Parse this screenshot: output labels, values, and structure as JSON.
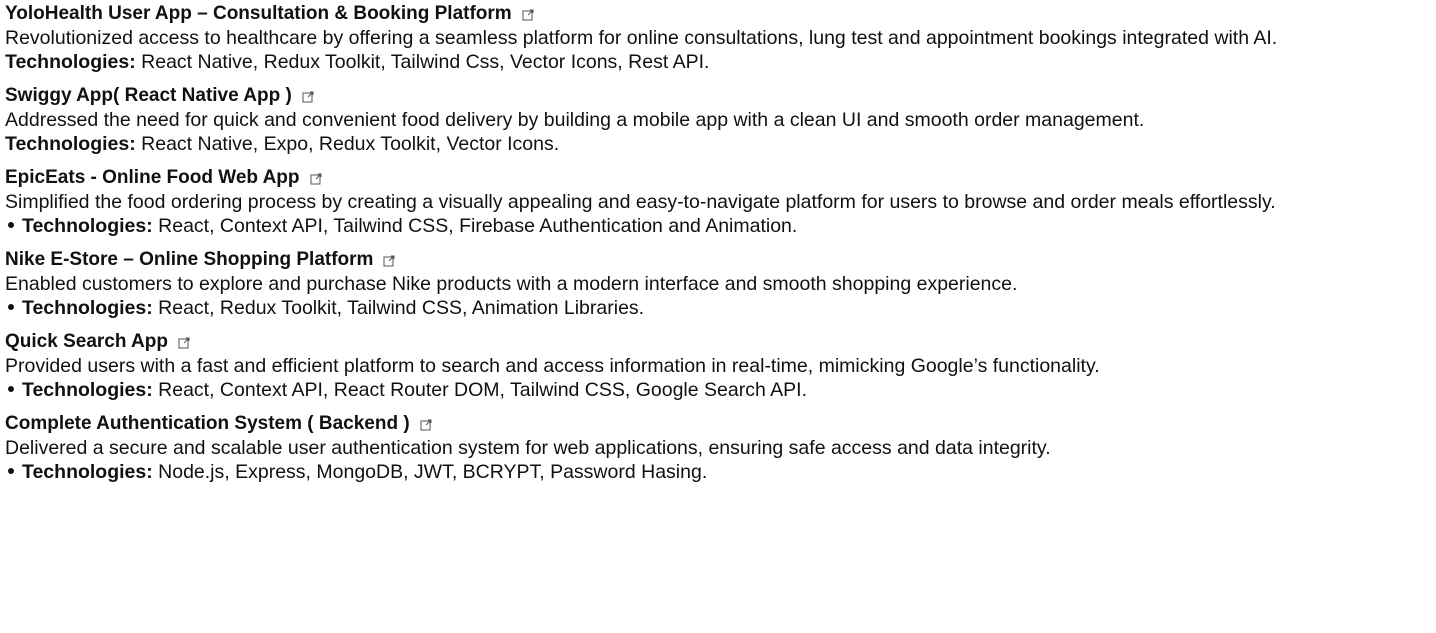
{
  "projects": [
    {
      "title": "YoloHealth User App – Consultation & Booking Platform",
      "description": "Revolutionized access to healthcare by offering a seamless platform for online consultations, lung test and appointment bookings integrated with AI.",
      "tech_label": "Technologies:",
      "tech": " React Native, Redux Toolkit, Tailwind Css, Vector Icons, Rest API.",
      "bullet": false
    },
    {
      "title": "Swiggy App( React Native App )",
      "description": "Addressed the need for quick and convenient food delivery by building a mobile app with a clean UI and smooth order management.",
      "tech_label": "Technologies:",
      "tech": " React Native, Expo, Redux Toolkit, Vector Icons.",
      "bullet": false
    },
    {
      "title": "EpicEats - Online Food Web App",
      "description": "Simplified the food ordering process by creating a visually appealing and easy-to-navigate platform for users to browse and order meals effortlessly.",
      "tech_label": "Technologies:",
      "tech": " React, Context API, Tailwind CSS, Firebase Authentication and Animation.",
      "bullet": true
    },
    {
      "title": "Nike E-Store – Online Shopping Platform",
      "description": "Enabled customers to explore and purchase Nike products with a modern interface and smooth shopping experience.",
      "tech_label": "Technologies:",
      "tech": " React, Redux Toolkit, Tailwind CSS, Animation Libraries.",
      "bullet": true
    },
    {
      "title": "Quick Search App",
      "description": "Provided users with a fast and efficient platform to search and access information in real-time, mimicking Google’s functionality.",
      "tech_label": "Technologies:",
      "tech": " React, Context API, React Router DOM, Tailwind CSS, Google Search API.",
      "bullet": true
    },
    {
      "title": "Complete Authentication System ( Backend )",
      "description": "Delivered a secure and scalable user authentication system for web applications, ensuring safe access and data integrity.",
      "tech_label": "Technologies:",
      "tech": " Node.js, Express, MongoDB, JWT, BCRYPT, Password Hasing.",
      "bullet": true
    }
  ],
  "icons": {
    "link": "external-link-icon"
  }
}
